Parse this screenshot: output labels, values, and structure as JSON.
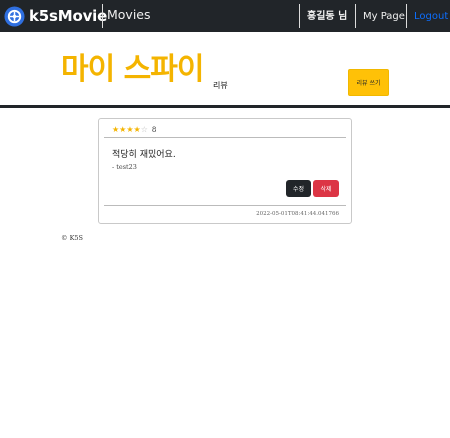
{
  "navbar": {
    "brand": "k5sMovie",
    "movies_link": "Movies",
    "user_greeting": "홍길동 님",
    "mypage_link": "My Page",
    "logout_link": "Logout",
    "colors": {
      "background": "#212529",
      "logout": "#0d6efd"
    }
  },
  "header": {
    "movie_title": "마이 스파이",
    "review_label": "리뷰",
    "write_button": "리뷰 쓰기",
    "colors": {
      "title": "#f4b400",
      "button": "#ffc107"
    }
  },
  "review": {
    "rating_value": "8",
    "stars_filled": 4,
    "stars_total": 5,
    "text": "적당히 재밌어요.",
    "author": "- test23",
    "edit_button": "수정",
    "delete_button": "삭제",
    "date": "2022-05-01T08:41:44.041766",
    "colors": {
      "edit": "#212529",
      "delete": "#dc3545"
    }
  },
  "footer": {
    "copyright": "© K5S"
  }
}
